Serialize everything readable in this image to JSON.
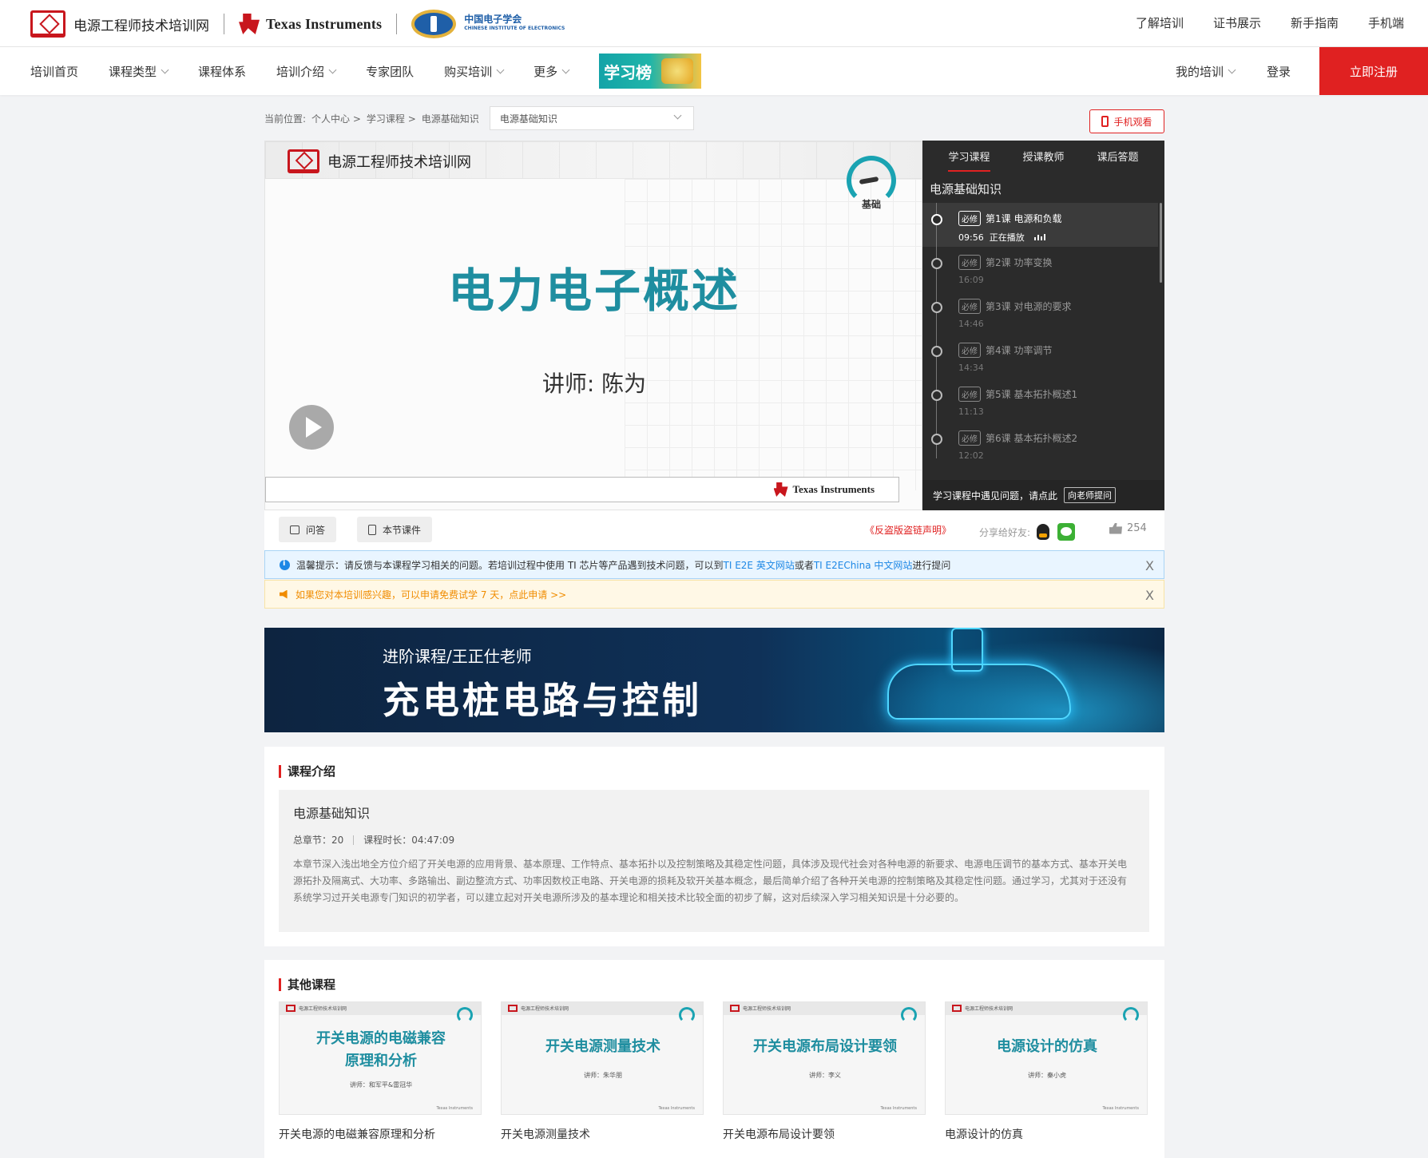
{
  "topbar": {
    "brand_name": "电源工程师技术培训网",
    "partner_ti": "Texas Instruments",
    "partner_cie": "中国电子学会",
    "partner_cie_sub": "CHINESE INSTITUTE OF ELECTRONICS",
    "links": [
      "了解培训",
      "证书展示",
      "新手指南",
      "手机端"
    ]
  },
  "nav": {
    "items": [
      {
        "label": "培训首页",
        "dropdown": false
      },
      {
        "label": "课程类型",
        "dropdown": true
      },
      {
        "label": "课程体系",
        "dropdown": false
      },
      {
        "label": "培训介绍",
        "dropdown": true
      },
      {
        "label": "专家团队",
        "dropdown": false
      },
      {
        "label": "购买培训",
        "dropdown": true
      },
      {
        "label": "更多",
        "dropdown": true
      }
    ],
    "leaderboard_label": "学习榜",
    "my_training": "我的培训",
    "login": "登录",
    "register": "立即注册"
  },
  "breadcrumb": {
    "prefix": "当前位置:",
    "items": [
      "个人中心 >",
      "学习课程 >",
      "电源基础知识"
    ],
    "select_value": "电源基础知识",
    "mobile_watch": "手机观看"
  },
  "player": {
    "slide_brand": "电源工程师技术培训网",
    "level": "基础",
    "slide_title": "电力电子概述",
    "slide_lecturer": "讲师: 陈为",
    "footer_brand": "Texas Instruments"
  },
  "side": {
    "tabs": [
      "学习课程",
      "授课教师",
      "课后答题"
    ],
    "course_name": "电源基础知识",
    "required_tag": "必修",
    "now_playing": "正在播放",
    "lessons": [
      {
        "title": "第1课 电源和负载",
        "time": "09:56",
        "active": true
      },
      {
        "title": "第2课 功率变换",
        "time": "16:09",
        "active": false
      },
      {
        "title": "第3课 对电源的要求",
        "time": "14:46",
        "active": false
      },
      {
        "title": "第4课 功率调节",
        "time": "14:34",
        "active": false
      },
      {
        "title": "第5课 基本拓扑概述1",
        "time": "11:13",
        "active": false
      },
      {
        "title": "第6课 基本拓扑概述2",
        "time": "12:02",
        "active": false
      }
    ],
    "footer_text": "学习课程中遇见问题，请点此",
    "ask_teacher": "向老师提问"
  },
  "actions": {
    "qa": "问答",
    "courseware": "本节课件",
    "antipiracy": "《反盗版盗链声明》",
    "share_label": "分享给好友:",
    "likes": "254"
  },
  "notices": {
    "info_pre": "温馨提示：请反馈与本课程学习相关的问题。若培训过程中使用 TI 芯片等产品遇到技术问题，可以到 ",
    "info_link1": "TI E2E 英文网站",
    "info_mid": "或者 ",
    "info_link2": "TI E2EChina 中文网站",
    "info_post": "进行提问",
    "trial": "如果您对本培训感兴趣，可以申请免费试学 7 天，点此申请 >>",
    "close": "X"
  },
  "banner": {
    "subtitle": "进阶课程/王正仕老师",
    "title": "充电桩电路与控制"
  },
  "intro": {
    "heading": "课程介绍",
    "course_title": "电源基础知识",
    "chapters_label": "总章节：20",
    "duration_label": "课程时长：04:47:09",
    "description": "本章节深入浅出地全方位介绍了开关电源的应用背景、基本原理、工作特点、基本拓扑以及控制策略及其稳定性问题，具体涉及现代社会对各种电源的新要求、电源电压调节的基本方式、基本开关电源拓扑及隔离式、大功率、多路输出、副边整流方式、功率因数校正电路、开关电源的损耗及软开关基本概念，最后简单介绍了各种开关电源的控制策略及其稳定性问题。通过学习，尤其对于还没有系统学习过开关电源专门知识的初学者，可以建立起对开关电源所涉及的基本理论和相关技术比较全面的初步了解，这对后续深入学习相关知识是十分必要的。"
  },
  "others": {
    "heading": "其他课程",
    "thumb_brand": "电源工程师技术培训网",
    "courses": [
      {
        "thumb_title": "开关电源的电磁兼容\n原理和分析",
        "lecturer": "讲师：和军平&雷冠华",
        "name": "开关电源的电磁兼容原理和分析"
      },
      {
        "thumb_title": "开关电源测量技术",
        "lecturer": "讲师：朱华朋",
        "name": "开关电源测量技术"
      },
      {
        "thumb_title": "开关电源布局设计要领",
        "lecturer": "讲师：李义",
        "name": "开关电源布局设计要领"
      },
      {
        "thumb_title": "电源设计的仿真",
        "lecturer": "讲师：秦小虎",
        "name": "电源设计的仿真"
      }
    ],
    "thumb_footer": "Texas Instruments"
  }
}
